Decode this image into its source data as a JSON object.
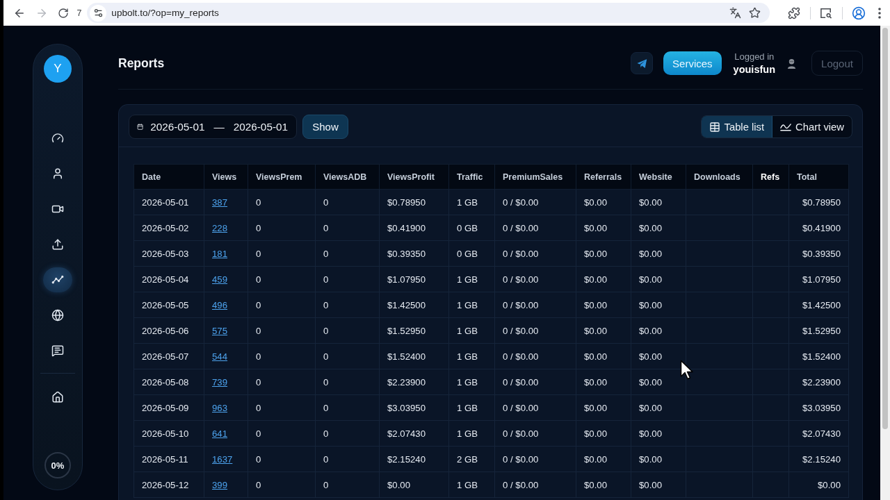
{
  "browser": {
    "back": {
      "disabled": false
    },
    "forward": {
      "disabled": true
    },
    "counter": "7",
    "url": "upbolt.to/?op=my_reports"
  },
  "sidebar": {
    "avatar_letter": "Y",
    "items": [
      {
        "selected": false
      },
      {
        "selected": false
      },
      {
        "selected": false
      },
      {
        "selected": false
      },
      {
        "selected": true
      },
      {
        "selected": false
      },
      {
        "selected": false
      }
    ],
    "home": {
      "selected": false
    },
    "progress": {
      "label": "0%",
      "level": 0
    }
  },
  "header": {
    "title": "Reports",
    "services_button": "Services",
    "login_label": "Logged in",
    "username": "youisfun",
    "logout_button": {
      "label": "Logout",
      "disabled": true
    }
  },
  "toolbar": {
    "date_range": {
      "from": "2026-05-01",
      "separator": "—",
      "to": "2026-05-01"
    },
    "show_button": "Show",
    "views": [
      {
        "label": "Table list",
        "selected": true
      },
      {
        "label": "Chart view",
        "selected": false
      }
    ]
  },
  "table": {
    "columns": [
      {
        "label": "Date",
        "emphasized": false
      },
      {
        "label": "Views",
        "emphasized": false
      },
      {
        "label": "ViewsPrem",
        "emphasized": false
      },
      {
        "label": "ViewsADB",
        "emphasized": false
      },
      {
        "label": "ViewsProfit",
        "emphasized": false
      },
      {
        "label": "Traffic",
        "emphasized": false
      },
      {
        "label": "PremiumSales",
        "emphasized": false
      },
      {
        "label": "Referrals",
        "emphasized": false
      },
      {
        "label": "Website",
        "emphasized": false
      },
      {
        "label": "Downloads",
        "emphasized": false
      },
      {
        "label": "Refs",
        "emphasized": true
      },
      {
        "label": "Total",
        "emphasized": false
      }
    ],
    "rows": [
      {
        "date": "2026-05-01",
        "views": "387",
        "views_prem": "0",
        "views_adb": "0",
        "views_profit": "$0.78950",
        "traffic": "1 GB",
        "premium_sales": "0 / $0.00",
        "referrals": "$0.00",
        "website": "$0.00",
        "total": "$0.78950"
      },
      {
        "date": "2026-05-02",
        "views": "228",
        "views_prem": "0",
        "views_adb": "0",
        "views_profit": "$0.41900",
        "traffic": "0 GB",
        "premium_sales": "0 / $0.00",
        "referrals": "$0.00",
        "website": "$0.00",
        "total": "$0.41900"
      },
      {
        "date": "2026-05-03",
        "views": "181",
        "views_prem": "0",
        "views_adb": "0",
        "views_profit": "$0.39350",
        "traffic": "0 GB",
        "premium_sales": "0 / $0.00",
        "referrals": "$0.00",
        "website": "$0.00",
        "total": "$0.39350"
      },
      {
        "date": "2026-05-04",
        "views": "459",
        "views_prem": "0",
        "views_adb": "0",
        "views_profit": "$1.07950",
        "traffic": "1 GB",
        "premium_sales": "0 / $0.00",
        "referrals": "$0.00",
        "website": "$0.00",
        "total": "$1.07950"
      },
      {
        "date": "2026-05-05",
        "views": "496",
        "views_prem": "0",
        "views_adb": "0",
        "views_profit": "$1.42500",
        "traffic": "1 GB",
        "premium_sales": "0 / $0.00",
        "referrals": "$0.00",
        "website": "$0.00",
        "total": "$1.42500"
      },
      {
        "date": "2026-05-06",
        "views": "575",
        "views_prem": "0",
        "views_adb": "0",
        "views_profit": "$1.52950",
        "traffic": "1 GB",
        "premium_sales": "0 / $0.00",
        "referrals": "$0.00",
        "website": "$0.00",
        "total": "$1.52950"
      },
      {
        "date": "2026-05-07",
        "views": "544",
        "views_prem": "0",
        "views_adb": "0",
        "views_profit": "$1.52400",
        "traffic": "1 GB",
        "premium_sales": "0 / $0.00",
        "referrals": "$0.00",
        "website": "$0.00",
        "total": "$1.52400"
      },
      {
        "date": "2026-05-08",
        "views": "739",
        "views_prem": "0",
        "views_adb": "0",
        "views_profit": "$2.23900",
        "traffic": "1 GB",
        "premium_sales": "0 / $0.00",
        "referrals": "$0.00",
        "website": "$0.00",
        "total": "$2.23900"
      },
      {
        "date": "2026-05-09",
        "views": "963",
        "views_prem": "0",
        "views_adb": "0",
        "views_profit": "$3.03950",
        "traffic": "1 GB",
        "premium_sales": "0 / $0.00",
        "referrals": "$0.00",
        "website": "$0.00",
        "total": "$3.03950"
      },
      {
        "date": "2026-05-10",
        "views": "641",
        "views_prem": "0",
        "views_adb": "0",
        "views_profit": "$2.07430",
        "traffic": "1 GB",
        "premium_sales": "0 / $0.00",
        "referrals": "$0.00",
        "website": "$0.00",
        "total": "$2.07430"
      },
      {
        "date": "2026-05-11",
        "views": "1637",
        "views_prem": "0",
        "views_adb": "0",
        "views_profit": "$2.15240",
        "traffic": "2 GB",
        "premium_sales": "0 / $0.00",
        "referrals": "$0.00",
        "website": "$0.00",
        "total": "$2.15240"
      },
      {
        "date": "2026-05-12",
        "views": "399",
        "views_prem": "0",
        "views_adb": "0",
        "views_profit": "$0.00",
        "traffic": "1 GB",
        "premium_sales": "0 / $0.00",
        "referrals": "$0.00",
        "website": "$0.00",
        "total": "$0.00"
      }
    ]
  }
}
